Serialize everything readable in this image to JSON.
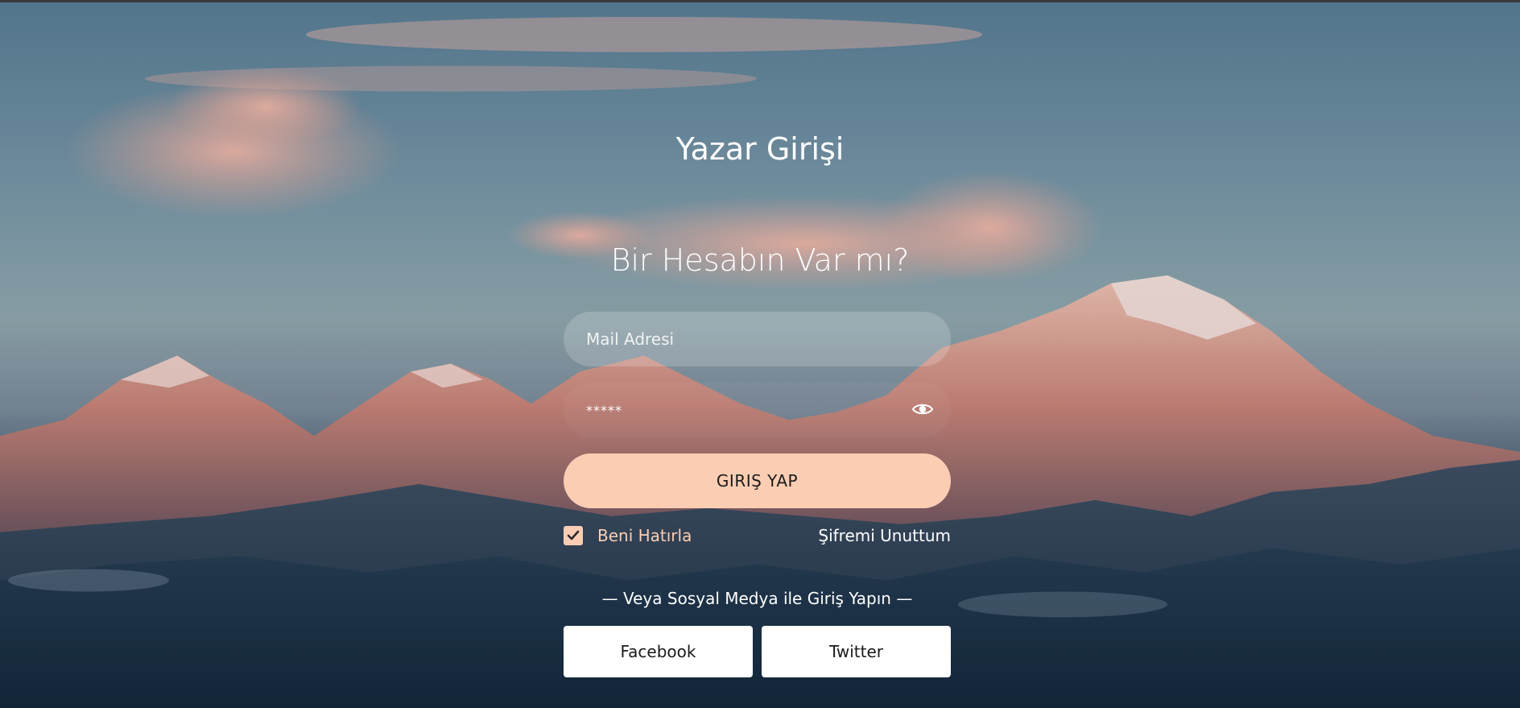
{
  "page": {
    "title": "Yazar Girişi",
    "subtitle": "Bir Hesabın Var mı?"
  },
  "form": {
    "email_placeholder": "Mail Adresi",
    "email_value": "",
    "password_value": "*****",
    "show_password_icon": "eye-icon",
    "submit_label": "GIRIŞ YAP",
    "remember_label": "Beni Hatırla",
    "remember_checked": true,
    "forgot_label": "Şifremi Unuttum"
  },
  "social": {
    "divider_text": "— Veya Sosyal Medya ile Giriş Yapın —",
    "facebook_label": "Facebook",
    "twitter_label": "Twitter"
  },
  "colors": {
    "accent": "#fbceb4",
    "text": "#ffffff"
  }
}
